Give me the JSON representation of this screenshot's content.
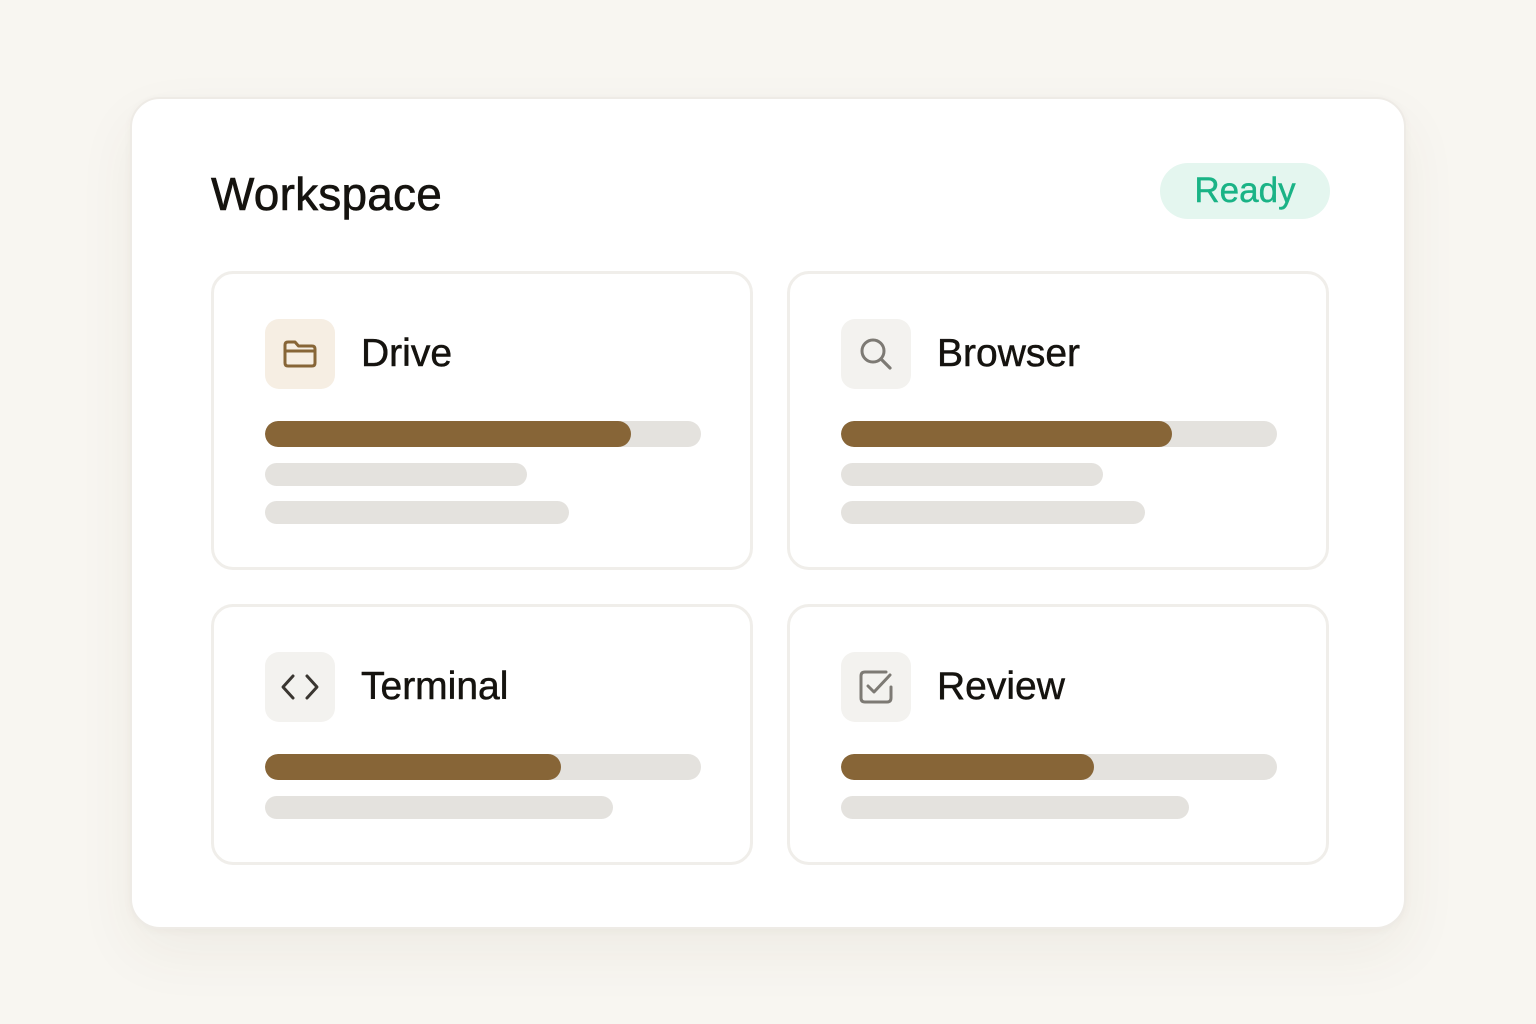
{
  "workspace": {
    "title": "Workspace",
    "status": "Ready",
    "status_color": "#1ab386",
    "accent_color": "#876537"
  },
  "cards": [
    {
      "label": "Drive",
      "icon": "folder-icon",
      "progress": 0.84
    },
    {
      "label": "Browser",
      "icon": "search-icon",
      "progress": 0.76
    },
    {
      "label": "Terminal",
      "icon": "code-icon",
      "progress": 0.68
    },
    {
      "label": "Review",
      "icon": "checkbox-icon",
      "progress": 0.58
    }
  ]
}
